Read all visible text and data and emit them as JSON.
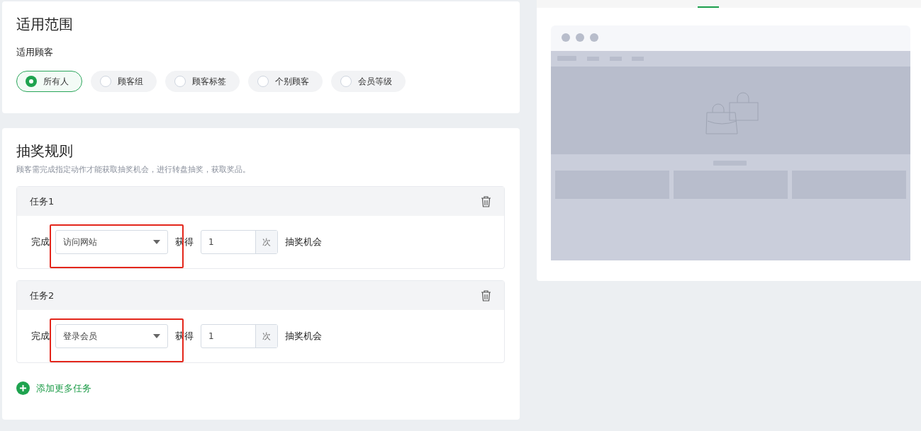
{
  "scope": {
    "title": "适用范围",
    "label": "适用顾客",
    "options": [
      {
        "label": "所有人",
        "selected": true
      },
      {
        "label": "顾客组",
        "selected": false
      },
      {
        "label": "顾客标签",
        "selected": false
      },
      {
        "label": "个别顾客",
        "selected": false
      },
      {
        "label": "会员等级",
        "selected": false
      }
    ]
  },
  "rules": {
    "title": "抽奖规则",
    "description": "顾客需完成指定动作才能获取抽奖机会，进行转盘抽奖，获取奖品。",
    "tasks": [
      {
        "title": "任务1",
        "prefix": "完成",
        "action": "访问网站",
        "gain_label": "获得",
        "count": "1",
        "unit": "次",
        "suffix": "抽奖机会",
        "highlighted": true
      },
      {
        "title": "任务2",
        "prefix": "完成",
        "action": "登录会员",
        "gain_label": "获得",
        "count": "1",
        "unit": "次",
        "suffix": "抽奖机会",
        "highlighted": true
      }
    ],
    "add_button": "添加更多任务"
  }
}
